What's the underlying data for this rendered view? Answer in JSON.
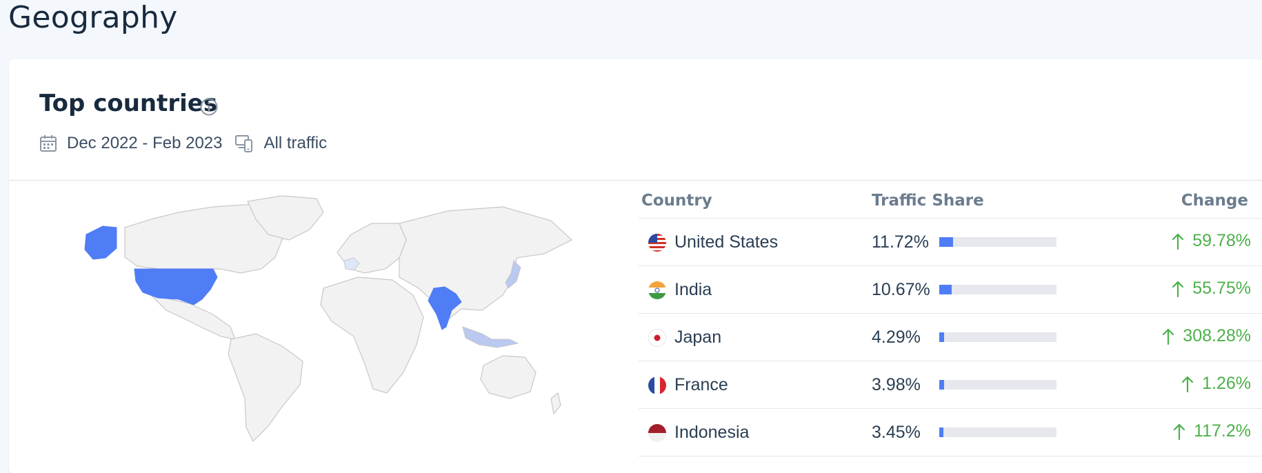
{
  "page": {
    "title": "Geography"
  },
  "card": {
    "title": "Top countries",
    "date_range": "Dec 2022 - Feb 2023",
    "traffic_type": "All traffic"
  },
  "table": {
    "headers": {
      "country": "Country",
      "share": "Traffic Share",
      "change": "Change"
    },
    "rows": [
      {
        "country": "United States",
        "share": "11.72%",
        "share_value": 11.72,
        "change": "59.78%",
        "direction": "up",
        "flag": "us-flag-icon"
      },
      {
        "country": "India",
        "share": "10.67%",
        "share_value": 10.67,
        "change": "55.75%",
        "direction": "up",
        "flag": "india-flag-icon"
      },
      {
        "country": "Japan",
        "share": "4.29%",
        "share_value": 4.29,
        "change": "308.28%",
        "direction": "up",
        "flag": "japan-flag-icon"
      },
      {
        "country": "France",
        "share": "3.98%",
        "share_value": 3.98,
        "change": "1.26%",
        "direction": "up",
        "flag": "france-flag-icon"
      },
      {
        "country": "Indonesia",
        "share": "3.45%",
        "share_value": 3.45,
        "change": "117.2%",
        "direction": "up",
        "flag": "indonesia-flag-icon"
      }
    ]
  },
  "colors": {
    "accent": "#4f7df5",
    "highlight_light": "#b9c9f0",
    "positive": "#4cb04a",
    "map_land": "#f2f2f2",
    "map_border": "#c8c8c8"
  }
}
